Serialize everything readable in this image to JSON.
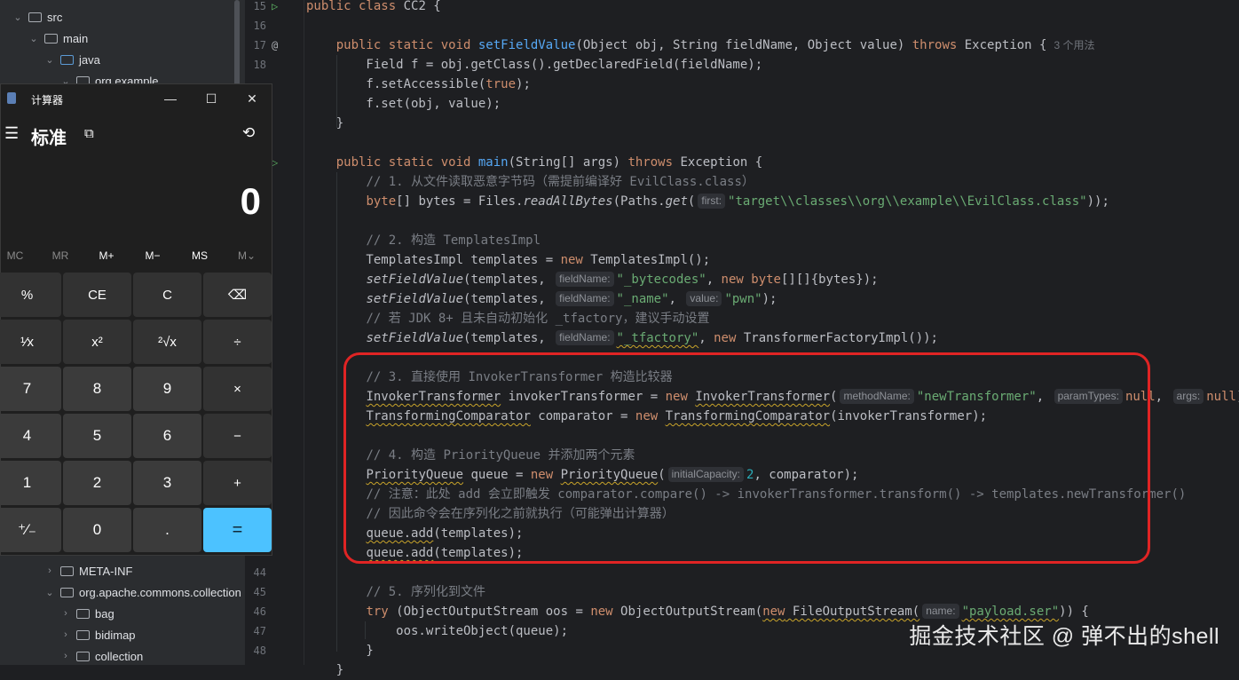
{
  "tree": {
    "items": [
      {
        "label": "src",
        "chevron": "⌄",
        "color": "gray"
      },
      {
        "label": "main",
        "chevron": "⌄",
        "color": "gray"
      },
      {
        "label": "java",
        "chevron": "⌄",
        "color": "blue"
      },
      {
        "label": "org.example",
        "chevron": "⌄",
        "color": "gray"
      },
      {
        "label": "META-INF",
        "chevron": "›",
        "color": "gray"
      },
      {
        "label": "org.apache.commons.collection",
        "chevron": "⌄",
        "color": "gray"
      },
      {
        "label": "bag",
        "chevron": "›",
        "color": "gray"
      },
      {
        "label": "bidimap",
        "chevron": "›",
        "color": "gray"
      },
      {
        "label": "collection",
        "chevron": "›",
        "color": "gray"
      }
    ]
  },
  "editor": {
    "line_numbers": [
      "15",
      "16",
      "17",
      "18",
      "",
      "",
      "",
      "",
      "",
      "",
      "",
      "",
      "",
      "",
      "",
      "",
      "",
      "",
      "",
      "",
      "",
      "",
      "",
      "",
      "",
      "",
      "",
      "",
      "",
      "44",
      "45",
      "46",
      "47",
      "48"
    ],
    "usage_hint": "3 个用法",
    "hints": {
      "first": "first:",
      "fieldName": "fieldName:",
      "value": "value:",
      "methodName": "methodName:",
      "paramTypes": "paramTypes:",
      "args": "args:",
      "initialCapacity": "initialCapacity:",
      "name": "name:"
    }
  },
  "calculator": {
    "title": "计算器",
    "mode": "标准",
    "display": "0",
    "window_buttons": {
      "minimize": "—",
      "maximize": "☐",
      "close": "✕"
    },
    "memory": [
      "MC",
      "MR",
      "M+",
      "M−",
      "MS",
      "M⌄"
    ],
    "keys": [
      [
        "%",
        "CE",
        "C",
        "⌫"
      ],
      [
        "¹⁄x",
        "x²",
        "²√x",
        "÷"
      ],
      [
        "7",
        "8",
        "9",
        "×"
      ],
      [
        "4",
        "5",
        "6",
        "−"
      ],
      [
        "1",
        "2",
        "3",
        "+"
      ],
      [
        "⁺⁄₋",
        "0",
        ".",
        "="
      ]
    ],
    "accent": "#4cc2ff"
  },
  "watermark": "掘金技术社区 @ 弹不出的shell",
  "colors": {
    "background": "#1e1f22",
    "keyword": "#cf8e6d",
    "function": "#56a8f5",
    "string": "#6aab73",
    "comment": "#7a7e85",
    "highlight_box": "#e02424"
  }
}
